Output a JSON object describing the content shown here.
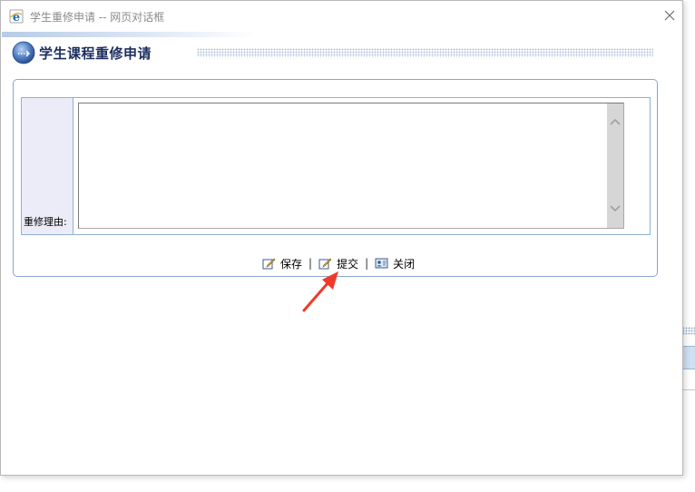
{
  "window": {
    "title": "学生重修申请 -- 网页对话框",
    "title_icon": "ie-icon",
    "close_icon": "close-icon"
  },
  "section": {
    "title": "学生课程重修申请",
    "icon": "info-globe-icon"
  },
  "form": {
    "reason_label": "重修理由:",
    "reason_value": "",
    "reason_placeholder": ""
  },
  "actions": {
    "save_label": "保存",
    "submit_label": "提交",
    "close_label": "关闭",
    "separator": "|",
    "save_icon": "edit-icon",
    "submit_icon": "edit-icon",
    "close_icon": "id-card-icon"
  },
  "annotation": {
    "arrow_color": "#ee3b2c",
    "arrow_icon": "red-arrow-icon"
  },
  "colors": {
    "title_text": "#1b2d5f",
    "panel_border": "#86a7cc",
    "label_bg": "#ececf8"
  }
}
